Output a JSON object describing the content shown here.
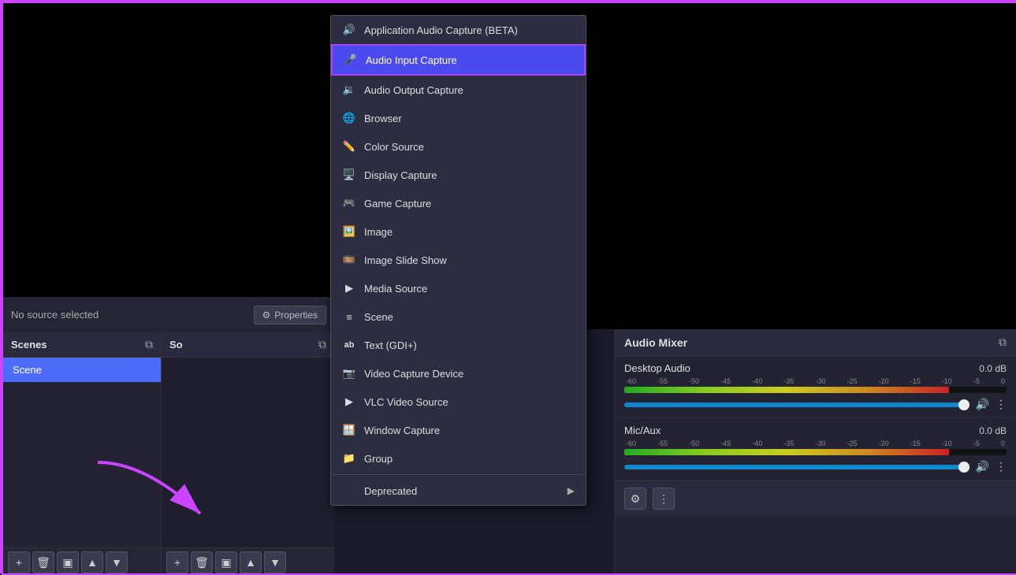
{
  "app": {
    "border_color": "#cc44ff"
  },
  "source_bar": {
    "no_source_label": "No source selected",
    "properties_label": "Properties"
  },
  "scenes_panel": {
    "title": "Scenes",
    "scene_name": "Scene"
  },
  "sources_panel": {
    "title": "So"
  },
  "audio_mixer": {
    "title": "Audio Mixer",
    "channels": [
      {
        "name": "Desktop Audio",
        "db": "0.0 dB",
        "scale": [
          "-60",
          "-55",
          "-50",
          "-45",
          "-40",
          "-35",
          "-30",
          "-25",
          "-20",
          "-15",
          "-10",
          "-5",
          "0"
        ]
      },
      {
        "name": "Mic/Aux",
        "db": "0.0 dB",
        "scale": [
          "-60",
          "-55",
          "-50",
          "-45",
          "-40",
          "-35",
          "-30",
          "-25",
          "-20",
          "-15",
          "-10",
          "-5",
          "0"
        ]
      }
    ]
  },
  "dropdown": {
    "items": [
      {
        "id": "app-audio",
        "icon": "🔊",
        "label": "Application Audio Capture (BETA)",
        "selected": false
      },
      {
        "id": "audio-input",
        "icon": "🎤",
        "label": "Audio Input Capture",
        "selected": true
      },
      {
        "id": "audio-output",
        "icon": "🔉",
        "label": "Audio Output Capture",
        "selected": false
      },
      {
        "id": "browser",
        "icon": "🌐",
        "label": "Browser",
        "selected": false
      },
      {
        "id": "color-source",
        "icon": "✏️",
        "label": "Color Source",
        "selected": false
      },
      {
        "id": "display-capture",
        "icon": "🖥️",
        "label": "Display Capture",
        "selected": false
      },
      {
        "id": "game-capture",
        "icon": "🎮",
        "label": "Game Capture",
        "selected": false
      },
      {
        "id": "image",
        "icon": "🖼️",
        "label": "Image",
        "selected": false
      },
      {
        "id": "image-slide-show",
        "icon": "🎞️",
        "label": "Image Slide Show",
        "selected": false
      },
      {
        "id": "media-source",
        "icon": "▶️",
        "label": "Media Source",
        "selected": false
      },
      {
        "id": "scene",
        "icon": "≡",
        "label": "Scene",
        "selected": false
      },
      {
        "id": "text-gdi",
        "icon": "ab",
        "label": "Text (GDI+)",
        "selected": false
      },
      {
        "id": "video-capture",
        "icon": "📷",
        "label": "Video Capture Device",
        "selected": false
      },
      {
        "id": "vlc-video",
        "icon": "▶️",
        "label": "VLC Video Source",
        "selected": false
      },
      {
        "id": "window-capture",
        "icon": "🪟",
        "label": "Window Capture",
        "selected": false
      }
    ],
    "separator_after": 14,
    "deprecated": {
      "label": "Deprecated",
      "has_arrow": true
    }
  },
  "toolbar": {
    "add": "+",
    "remove": "🗑",
    "filter": "▣",
    "up": "▲",
    "down": "▼",
    "gear": "⚙",
    "dots": "⋮"
  }
}
